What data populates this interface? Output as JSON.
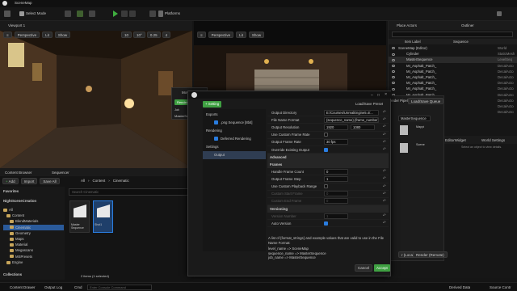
{
  "title_bar": {
    "tab": "SceneMap"
  },
  "main_toolbar": {
    "select_mode": "Select Mode",
    "platforms": "Platforms"
  },
  "viewport": {
    "tab": "Viewport 1",
    "perspective": "Perspective",
    "lit": "Lit",
    "show": "Show",
    "values": [
      "10",
      "10°",
      "0.25",
      "4"
    ]
  },
  "viewport2": {
    "perspective": "Perspective",
    "lit": "Lit",
    "show": "Show"
  },
  "place_actors": {
    "tab1": "Place Actors",
    "tab2": "Outliner",
    "col_item": "Item Label",
    "col_type": "Sequence",
    "items": [
      {
        "label": "SceneMap (Editor)",
        "type": "World"
      },
      {
        "label": "Cylinder",
        "type": "StaticMesh"
      },
      {
        "label": "MasterSequence",
        "type": "LevelSeq"
      },
      {
        "label": "MI_Asphalt_Patch_",
        "type": "DecalActo"
      },
      {
        "label": "MI_Asphalt_Patch_",
        "type": "DecalActo"
      },
      {
        "label": "MI_Asphalt_Patch_",
        "type": "DecalActo"
      },
      {
        "label": "MI_Asphalt_Patch_",
        "type": "DecalActo"
      },
      {
        "label": "MI_Asphalt_Patch_",
        "type": "DecalActo"
      },
      {
        "label": "MI_Asphalt_Patch_",
        "type": "DecalActo"
      },
      {
        "label": "MI_Asphalt_Patch_",
        "type": "DecalActo"
      },
      {
        "label": "MI_Asphalt_Patch_",
        "type": "DecalActo"
      },
      {
        "label": "MI_Asphalt_Patch_",
        "type": "DecalActo"
      }
    ]
  },
  "details": {
    "tab1": "EditorWidget",
    "tab2": "World Settings",
    "hint": "Select an object to view details."
  },
  "content_browser": {
    "tab1": "Content Browser",
    "tab2": "Sequencer",
    "add": "Add",
    "import": "Import",
    "save_all": "Save All",
    "path": [
      "All",
      "Content",
      "Cinematic"
    ],
    "favorites": "Favorites",
    "project": "NightSceneCreation",
    "folders": [
      "All",
      "Content",
      "BlendMaterials",
      "Cinematic",
      "Geometry",
      "Maps",
      "Material",
      "Megascans",
      "MSPresets",
      "Engine"
    ],
    "search": "Search Cinematic",
    "assets": [
      {
        "name": "Master Sequence"
      },
      {
        "name": "Shot1"
      }
    ],
    "status": "2 items (1 selected)",
    "collections": "Collections"
  },
  "mrq": {
    "title": "Movie R",
    "render": "Render",
    "job": "Job",
    "job_item": "MasterSequence",
    "settings_btn": "Setting",
    "load_save": "Load/Save Preset",
    "tree": [
      {
        "label": "Exports",
        "indent": 0
      },
      {
        "label": ".png Sequence [8bit]",
        "indent": 1
      },
      {
        "label": "Rendering",
        "indent": 0
      },
      {
        "label": "Deferred Rendering",
        "indent": 1
      },
      {
        "label": "Settings",
        "indent": 0
      },
      {
        "label": "Output",
        "indent": 1,
        "selected": true
      }
    ],
    "rows": [
      {
        "label": "Output Directory",
        "value": "E:/Courses/UnrealEngine5.4/...",
        "type": "field"
      },
      {
        "label": "File Name Format",
        "value": "{sequence_name}.{frame_number}",
        "type": "field"
      },
      {
        "label": "Output Resolution",
        "value": [
          "1920",
          "1080"
        ],
        "type": "pair"
      },
      {
        "label": "Use Custom Frame Rate",
        "value": "",
        "type": "check"
      },
      {
        "label": "Output Frame Rate",
        "value": "30 fps",
        "type": "field"
      },
      {
        "label": "Override Existing Output",
        "value": "",
        "type": "check_on"
      },
      {
        "label": "Advanced",
        "value": "",
        "type": "sect"
      },
      {
        "label": "Frames",
        "value": "",
        "type": "sect"
      },
      {
        "label": "Handle Frame Count",
        "value": "0",
        "type": "field"
      },
      {
        "label": "Output Frame Step",
        "value": "1",
        "type": "field"
      },
      {
        "label": "Use Custom Playback Range",
        "value": "",
        "type": "check"
      },
      {
        "label": "Custom Start Frame",
        "value": "0",
        "type": "field_dis"
      },
      {
        "label": "Custom End Frame",
        "value": "0",
        "type": "field_dis"
      },
      {
        "label": "Versioning",
        "value": "",
        "type": "sect"
      },
      {
        "label": "Version Number",
        "value": "1",
        "type": "field_dis"
      },
      {
        "label": "Auto Version",
        "value": "",
        "type": "check_on"
      }
    ],
    "help": "A list of {format_strings} and example values that are valid to use in the File Name Format:",
    "help_lines": [
      "level_name => SceneMap",
      "sequence_name => MasterSequence",
      "job_name => MasterSequence"
    ],
    "cancel": "Cancel",
    "accept": "Accept"
  },
  "queue_panel": {
    "title": "ender Pipeline",
    "load_save": "Load/Save Queue",
    "field": "MasterSequence",
    "map": "Mappi",
    "scene": "Scene",
    "local": "r (Local)",
    "remote": "Render (Remote)"
  },
  "status_bar": {
    "drawer": "Content Drawer",
    "output_log": "Output Log",
    "cmd": "Cmd",
    "console": "Enter Console Command",
    "derived": "Derived Data",
    "source": "Source Contr"
  }
}
